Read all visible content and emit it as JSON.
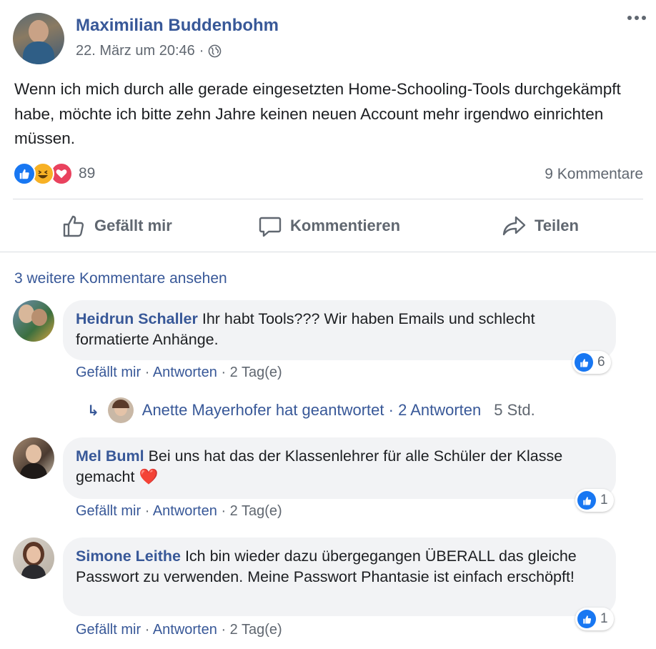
{
  "post": {
    "author": "Maximilian Buddenbohm",
    "date": "22. März um 20:46",
    "separator": "·",
    "privacy_icon": "globe-icon",
    "text": "Wenn ich mich durch alle gerade eingesetzten Home-Schooling-Tools durchgekämpft habe, möchte ich bitte zehn Jahre keinen neuen Account mehr irgendwo einrichten müssen.",
    "reactions": [
      "like-icon",
      "haha-icon",
      "love-icon"
    ],
    "reaction_count": "89",
    "comment_count": "9 Kommentare"
  },
  "actions": {
    "like": "Gefällt mir",
    "comment": "Kommentieren",
    "share": "Teilen"
  },
  "more_comments": "3 weitere Kommentare ansehen",
  "comments": [
    {
      "name": "Heidrun Schaller",
      "text": "Ihr habt Tools??? Wir haben Emails und schlecht formatierte Anhänge.",
      "likes": "6",
      "like": "Gefällt mir",
      "reply": "Antworten",
      "time": "2 Tag(e)",
      "dot": "·"
    },
    {
      "name": "Mel Buml",
      "text": "Bei uns hat das der Klassenlehrer für alle Schüler der Klasse gemacht",
      "emoji": "❤️",
      "likes": "1",
      "like": "Gefällt mir",
      "reply": "Antworten",
      "time": "2 Tag(e)",
      "dot": "·"
    },
    {
      "name": "Simone Leithe",
      "text": "Ich bin wieder dazu übergegangen ÜBERALL das gleiche Passwort zu verwenden. Meine Passwort Phantasie ist einfach erschöpft!",
      "likes": "1",
      "like": "Gefällt mir",
      "reply": "Antworten",
      "time": "2 Tag(e)",
      "dot": "·"
    }
  ],
  "reply_thread": {
    "arrow": "↳",
    "text": "Anette Mayerhofer hat geantwortet · 2 Antworten",
    "time": "5 Std."
  },
  "colors": {
    "link": "#385898",
    "muted": "#606770",
    "bubble": "#f2f3f5",
    "like_blue": "#1877f2"
  }
}
